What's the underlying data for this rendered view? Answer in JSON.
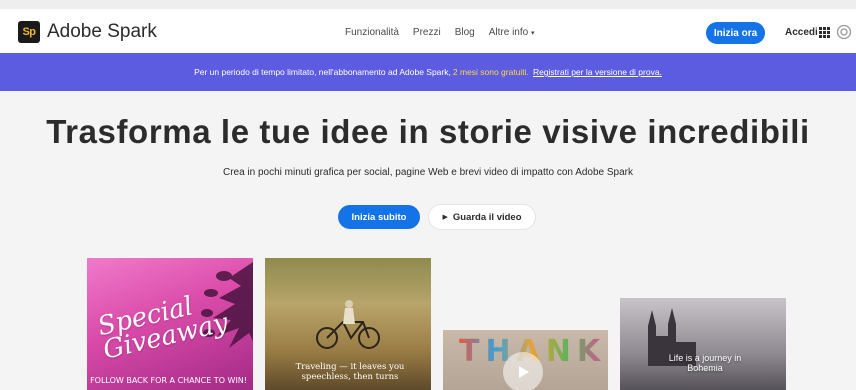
{
  "header": {
    "logo_badge": "Sp",
    "logo_text": "Adobe Spark",
    "nav": [
      "Funzionalità",
      "Prezzi",
      "Blog",
      "Altre info"
    ],
    "cta_label": "Inizia ora",
    "login_label": "Accedi",
    "icons": [
      "chevron-down-icon",
      "apps-grid-icon",
      "creative-cloud-icon"
    ]
  },
  "promo": {
    "text_before": "Per un periodo di tempo limitato, nell'abbonamento ad Adobe Spark,",
    "highlight": "2 mesi sono gratuiti.",
    "link": "Registrati per la versione di prova."
  },
  "hero": {
    "title": "Trasforma le tue idee in storie visive incredibili",
    "subtitle": "Crea in pochi minuti grafica per social, pagine Web e brevi video di impatto con Adobe Spark",
    "primary_button": "Inizia subito",
    "secondary_button": "Guarda il video"
  },
  "cards": [
    {
      "title": "Special Giveaway",
      "subtitle": "FOLLOW BACK FOR A CHANCE TO WIN!"
    },
    {
      "title": "Traveling — it leaves you speechless, then turns"
    },
    {
      "title": "THANK"
    },
    {
      "title": "Life is a journey in Bohemia"
    }
  ],
  "colors": {
    "accent": "#1473e6",
    "promo_bg": "#5c5ce0",
    "promo_highlight": "#ffd83d",
    "page_bg": "#f4f4f4"
  }
}
